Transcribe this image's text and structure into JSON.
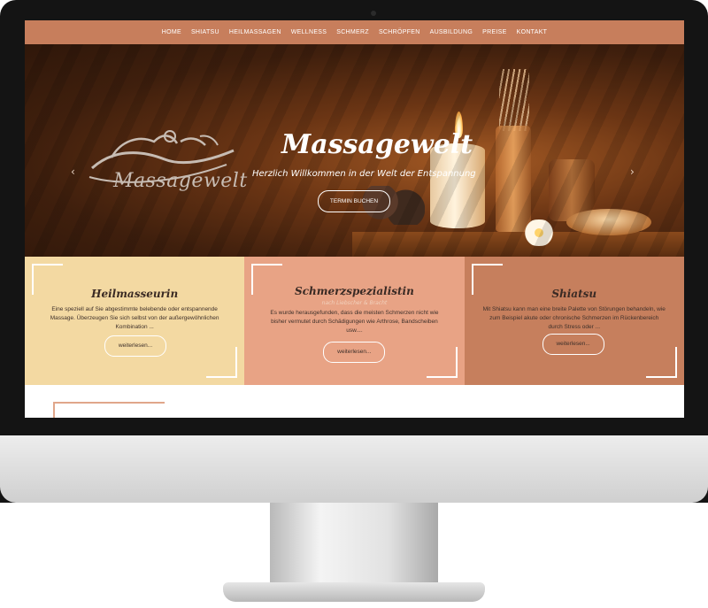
{
  "nav": {
    "items": [
      {
        "label": "HOME"
      },
      {
        "label": "SHIATSU"
      },
      {
        "label": "HEILMASSAGEN"
      },
      {
        "label": "WELLNESS"
      },
      {
        "label": "SCHMERZ"
      },
      {
        "label": "SCHRÖPFEN"
      },
      {
        "label": "AUSBILDUNG"
      },
      {
        "label": "PREISE"
      },
      {
        "label": "KONTAKT"
      }
    ]
  },
  "hero": {
    "logo_text": "Massagewelt",
    "title": "Massagewelt",
    "subtitle": "Herzlich Willkommen in der Welt der Entspannung",
    "button_label": "TERMIN BUCHEN",
    "prev_arrow": "‹",
    "next_arrow": "›",
    "slides": 3,
    "active_slide": 1
  },
  "features": [
    {
      "title": "Heilmasseurin",
      "subtitle": "",
      "text": "Eine speziell auf Sie abgestimmte belebende oder entspannende Massage. Überzeugen Sie sich selbst von der außergewöhnlichen Kombination ...",
      "button": "weiterlesen...",
      "color": "#f3d9a2"
    },
    {
      "title": "Schmerzspezialistin",
      "subtitle": "nach Liebscher & Bracht",
      "text": "Es wurde herausgefunden, dass die meisten Schmerzen nicht wie bisher vermutet durch Schädigungen wie Arthrose, Bandscheiben usw....",
      "button": "weiterlesen...",
      "color": "#e8a385"
    },
    {
      "title": "Shiatsu",
      "subtitle": "",
      "text": "Mit Shiatsu kann man eine breite Palette von Störungen behandeln, wie zum Beispiel akute oder chronische Schmerzen im Rückenbereich durch Stress oder ...",
      "button": "weiterlesen...",
      "color": "#c67f5d"
    }
  ],
  "colors": {
    "nav": "#c77e5c",
    "hero_dark": "#3f1f0d",
    "monitor_bezel": "#141414"
  }
}
